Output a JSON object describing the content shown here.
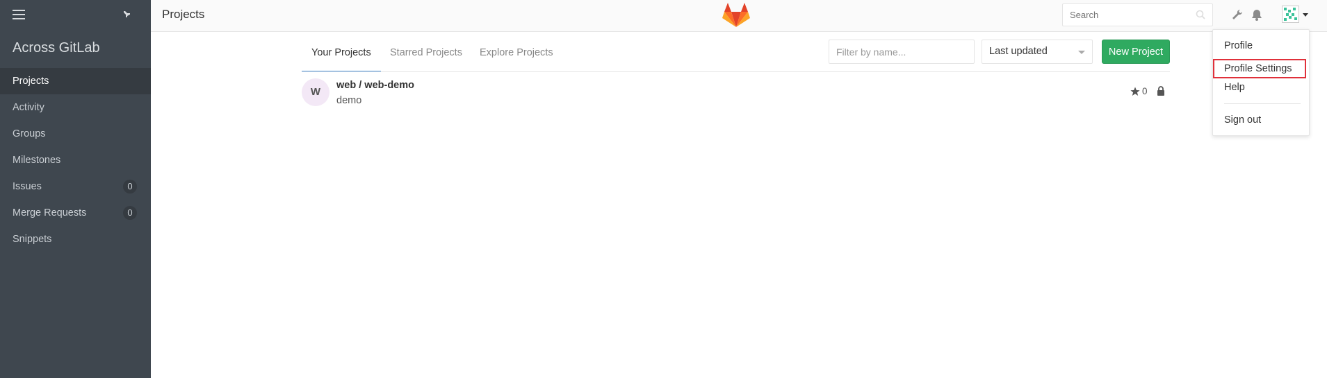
{
  "sidebar": {
    "brand": "Across GitLab",
    "items": [
      {
        "label": "Projects",
        "active": true
      },
      {
        "label": "Activity"
      },
      {
        "label": "Groups"
      },
      {
        "label": "Milestones"
      },
      {
        "label": "Issues",
        "count": "0"
      },
      {
        "label": "Merge Requests",
        "count": "0"
      },
      {
        "label": "Snippets"
      }
    ]
  },
  "header": {
    "title": "Projects",
    "search_placeholder": "Search"
  },
  "tabs": [
    {
      "label": "Your Projects",
      "active": true
    },
    {
      "label": "Starred Projects"
    },
    {
      "label": "Explore Projects"
    }
  ],
  "filter": {
    "placeholder": "Filter by name...",
    "sort_selected": "Last updated",
    "new_project_label": "New Project"
  },
  "projects": [
    {
      "avatar_letter": "W",
      "name": "web / web-demo",
      "description": "demo",
      "stars": "0"
    }
  ],
  "user_menu": {
    "items": [
      "Profile",
      "Profile Settings",
      "Help",
      "Sign out"
    ],
    "highlighted": "Profile Settings"
  },
  "colors": {
    "sidebar_bg": "#3f474f",
    "accent_tab": "#4a90d9",
    "new_project_green": "#2faa60",
    "highlight_box": "#e0303a"
  }
}
